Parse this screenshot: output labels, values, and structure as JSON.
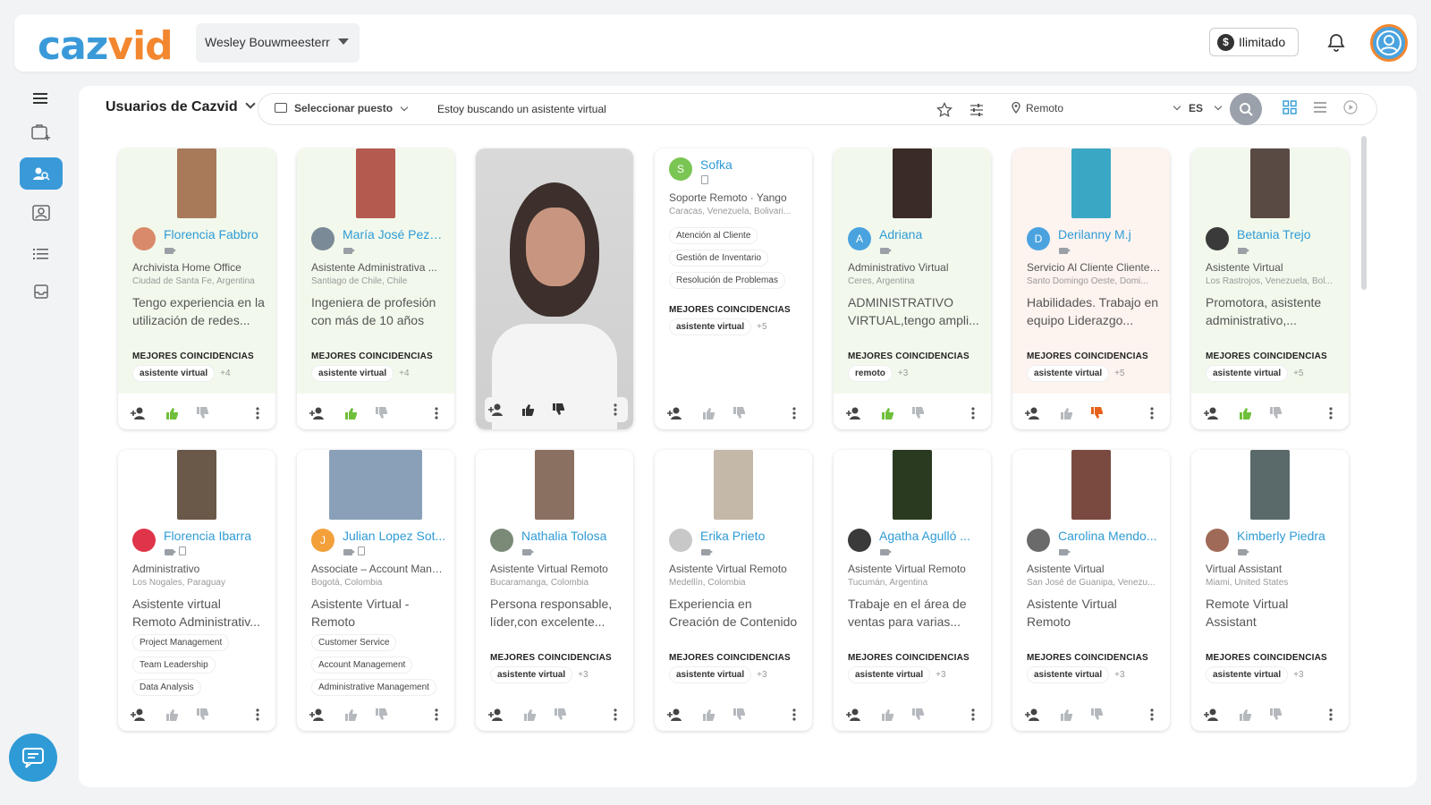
{
  "header": {
    "logo_main": "caz",
    "logo_accent": "vid",
    "user_selector": "Wesley Bouwmeesterr",
    "plan_label": "Ilimitado",
    "plan_icon": "dollar-coin-icon",
    "notifications_icon": "bell-icon",
    "avatar_icon": "user-avatar-icon"
  },
  "sidebar": {
    "items": [
      {
        "name": "menu-icon"
      },
      {
        "name": "new-job-icon"
      },
      {
        "name": "user-search-icon",
        "active": true
      },
      {
        "name": "contacts-icon"
      },
      {
        "name": "list-icon"
      },
      {
        "name": "inbox-icon"
      }
    ]
  },
  "filters": {
    "category": "Usuarios de Cazvid",
    "job_select": "Seleccionar puesto",
    "query": "Estoy buscando un asistente virtual",
    "location": "Remoto",
    "language": "ES"
  },
  "colors": {
    "accent": "#2f9bd6",
    "brand_orange": "#f3872f",
    "like": "#6fbf3b",
    "dislike": "#e8621b",
    "icon_gray": "#9aa0a6"
  },
  "cards": [
    {
      "name": "Florencia Fabbro",
      "avatar_letter": "",
      "avatar_color": "#d98a6a",
      "role": "Archivista Home Office",
      "place": "Ciudad de Santa Fe, Argentina",
      "bio": "Tengo experiencia en la utilización de redes...",
      "mc": "MEJORES COINCIDENCIAS",
      "tag": "asistente virtual",
      "more": "+4",
      "tint": "#f2f9ec",
      "like": true,
      "dislike": false,
      "photo": "#a87a5a"
    },
    {
      "name": "María José Pezo...",
      "avatar_letter": "",
      "avatar_color": "#7a8a96",
      "role": "Asistente Administrativa ...",
      "place": "Santiago de Chile, Chile",
      "bio": "Ingeniera de profesión con más de 10 años en...",
      "mc": "MEJORES COINCIDENCIAS",
      "tag": "asistente virtual",
      "more": "+4",
      "tint": "#f2f9ec",
      "like": true,
      "dislike": false,
      "photo": "#b45a4e"
    },
    {
      "name": "",
      "hover": true
    },
    {
      "name": "Sofka",
      "avatar_letter": "S",
      "avatar_color": "#7ac553",
      "role": "Soporte Remoto · Yango",
      "place": "Caracas, Venezuela, Bolivari...",
      "skills": [
        "Atención al Cliente",
        "Gestión de Inventario",
        "Resolución de Problemas"
      ],
      "mc": "MEJORES COINCIDENCIAS",
      "tag": "asistente virtual",
      "more": "+5",
      "tint": "#ffffff",
      "like": false,
      "dislike": false,
      "photo": ""
    },
    {
      "name": "Adriana",
      "avatar_letter": "A",
      "avatar_color": "#4aa3df",
      "role": "Administrativo Virtual",
      "place": "Ceres, Argentina",
      "bio": "ADMINISTRATIVO VIRTUAL,tengo ampli...",
      "mc": "MEJORES COINCIDENCIAS",
      "tag": "remoto",
      "more": "+3",
      "tint": "#f2f9ec",
      "like": true,
      "dislike": false,
      "photo": "#3a2a28"
    },
    {
      "name": "Derilanny M.j",
      "avatar_letter": "D",
      "avatar_color": "#4aa3df",
      "role": "Servicio Al Cliente Cliente ...",
      "place": "Santo Domingo Oeste, Domi...",
      "bio": "Habilidades. Trabajo en equipo Liderazgo...",
      "mc": "MEJORES COINCIDENCIAS",
      "tag": "asistente virtual",
      "more": "+5",
      "tint": "#fdf3ef",
      "like": false,
      "dislike": true,
      "photo": "#3aa7c4"
    },
    {
      "name": "Betania Trejo",
      "avatar_letter": "",
      "avatar_color": "#3a3a3a",
      "role": "Asistente Virtual",
      "place": "Los Rastrojos, Venezuela, Bol...",
      "bio": "Promotora, asistente administrativo,...",
      "mc": "MEJORES COINCIDENCIAS",
      "tag": "asistente virtual",
      "more": "+5",
      "tint": "#f2f9ec",
      "like": true,
      "dislike": false,
      "photo": "#5a4a44"
    },
    {
      "name": "Florencia Ibarra",
      "avatar_letter": "",
      "avatar_color": "#e0344a",
      "role": "Administrativo",
      "place": "Los Nogales, Paraguay",
      "bio": "Asistente virtual Remoto Administrativ...",
      "skills": [
        "Project Management",
        "Team Leadership",
        "Data Analysis"
      ],
      "tint": "#ffffff",
      "like": false,
      "dislike": false,
      "photo": "#6a5848",
      "doc": true
    },
    {
      "name": "Julian Lopez Sot...",
      "avatar_letter": "J",
      "avatar_color": "#f3a03a",
      "role": "Associate – Account Mana...",
      "place": "Bogotá, Colombia",
      "bio": "Asistente Virtual - Remoto",
      "skills": [
        "Customer Service",
        "Account Management",
        "Administrative Management"
      ],
      "tint": "#ffffff",
      "like": false,
      "dislike": false,
      "photo": "#8aa0b8",
      "wide": true,
      "doc": true
    },
    {
      "name": "Nathalia Tolosa",
      "avatar_letter": "",
      "avatar_color": "#7a8a76",
      "role": "Asistente Virtual Remoto",
      "place": "Bucaramanga, Colombia",
      "bio": "Persona responsable, líder,con excelente...",
      "mc": "MEJORES COINCIDENCIAS",
      "tag": "asistente virtual",
      "more": "+3",
      "tint": "#ffffff",
      "like": false,
      "dislike": false,
      "photo": "#8a7060"
    },
    {
      "name": "Erika Prieto",
      "avatar_letter": "",
      "avatar_color": "#c8c8c8",
      "role": "Asistente Virtual Remoto",
      "place": "Medellín, Colombia",
      "bio": "Experiencia en Creación de Contenido para...",
      "mc": "MEJORES COINCIDENCIAS",
      "tag": "asistente virtual",
      "more": "+3",
      "tint": "#ffffff",
      "like": false,
      "dislike": false,
      "photo": "#c4b8a8"
    },
    {
      "name": "Agatha Agulló ...",
      "avatar_letter": "",
      "avatar_color": "#3a3a3a",
      "role": "Asistente Virtual Remoto",
      "place": "Tucumán, Argentina",
      "bio": "Trabaje en el área de ventas para varias...",
      "mc": "MEJORES COINCIDENCIAS",
      "tag": "asistente virtual",
      "more": "+3",
      "tint": "#ffffff",
      "like": false,
      "dislike": false,
      "photo": "#2a3a20"
    },
    {
      "name": "Carolina Mendo...",
      "avatar_letter": "",
      "avatar_color": "#6a6a6a",
      "role": "Asistente Virtual",
      "place": "San José de Guanipa, Venezu...",
      "bio": "Asistente Virtual Remoto",
      "mc": "MEJORES COINCIDENCIAS",
      "tag": "asistente virtual",
      "more": "+3",
      "tint": "#ffffff",
      "like": false,
      "dislike": false,
      "photo": "#7a4a40"
    },
    {
      "name": "Kimberly Piedra",
      "avatar_letter": "",
      "avatar_color": "#a06a58",
      "role": "Virtual Assistant",
      "place": "Miami, United States",
      "bio": "Remote Virtual Assistant",
      "mc": "MEJORES COINCIDENCIAS",
      "tag": "asistente virtual",
      "more": "+3",
      "tint": "#ffffff",
      "like": false,
      "dislike": false,
      "photo": "#5a6a6a"
    }
  ]
}
